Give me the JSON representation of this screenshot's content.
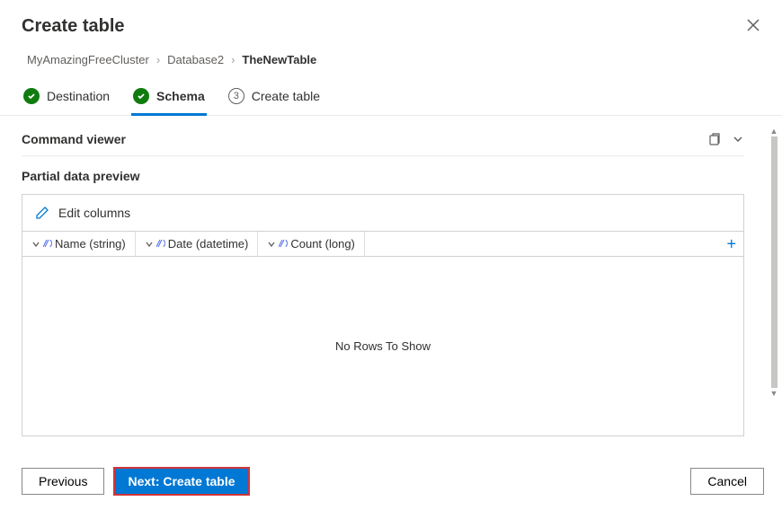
{
  "header": {
    "title": "Create table"
  },
  "breadcrumb": {
    "items": [
      {
        "label": "MyAmazingFreeCluster",
        "current": false
      },
      {
        "label": "Database2",
        "current": false
      },
      {
        "label": "TheNewTable",
        "current": true
      }
    ]
  },
  "steps": [
    {
      "label": "Destination",
      "state": "done"
    },
    {
      "label": "Schema",
      "state": "done",
      "active": true
    },
    {
      "label": "Create table",
      "state": "pending",
      "num": "3"
    }
  ],
  "command_viewer": {
    "title": "Command viewer"
  },
  "preview": {
    "title": "Partial data preview",
    "edit_label": "Edit columns",
    "empty_text": "No Rows To Show",
    "columns": [
      {
        "label": "Name (string)"
      },
      {
        "label": "Date (datetime)"
      },
      {
        "label": "Count (long)"
      }
    ]
  },
  "footer": {
    "previous": "Previous",
    "next": "Next: Create table",
    "cancel": "Cancel"
  }
}
